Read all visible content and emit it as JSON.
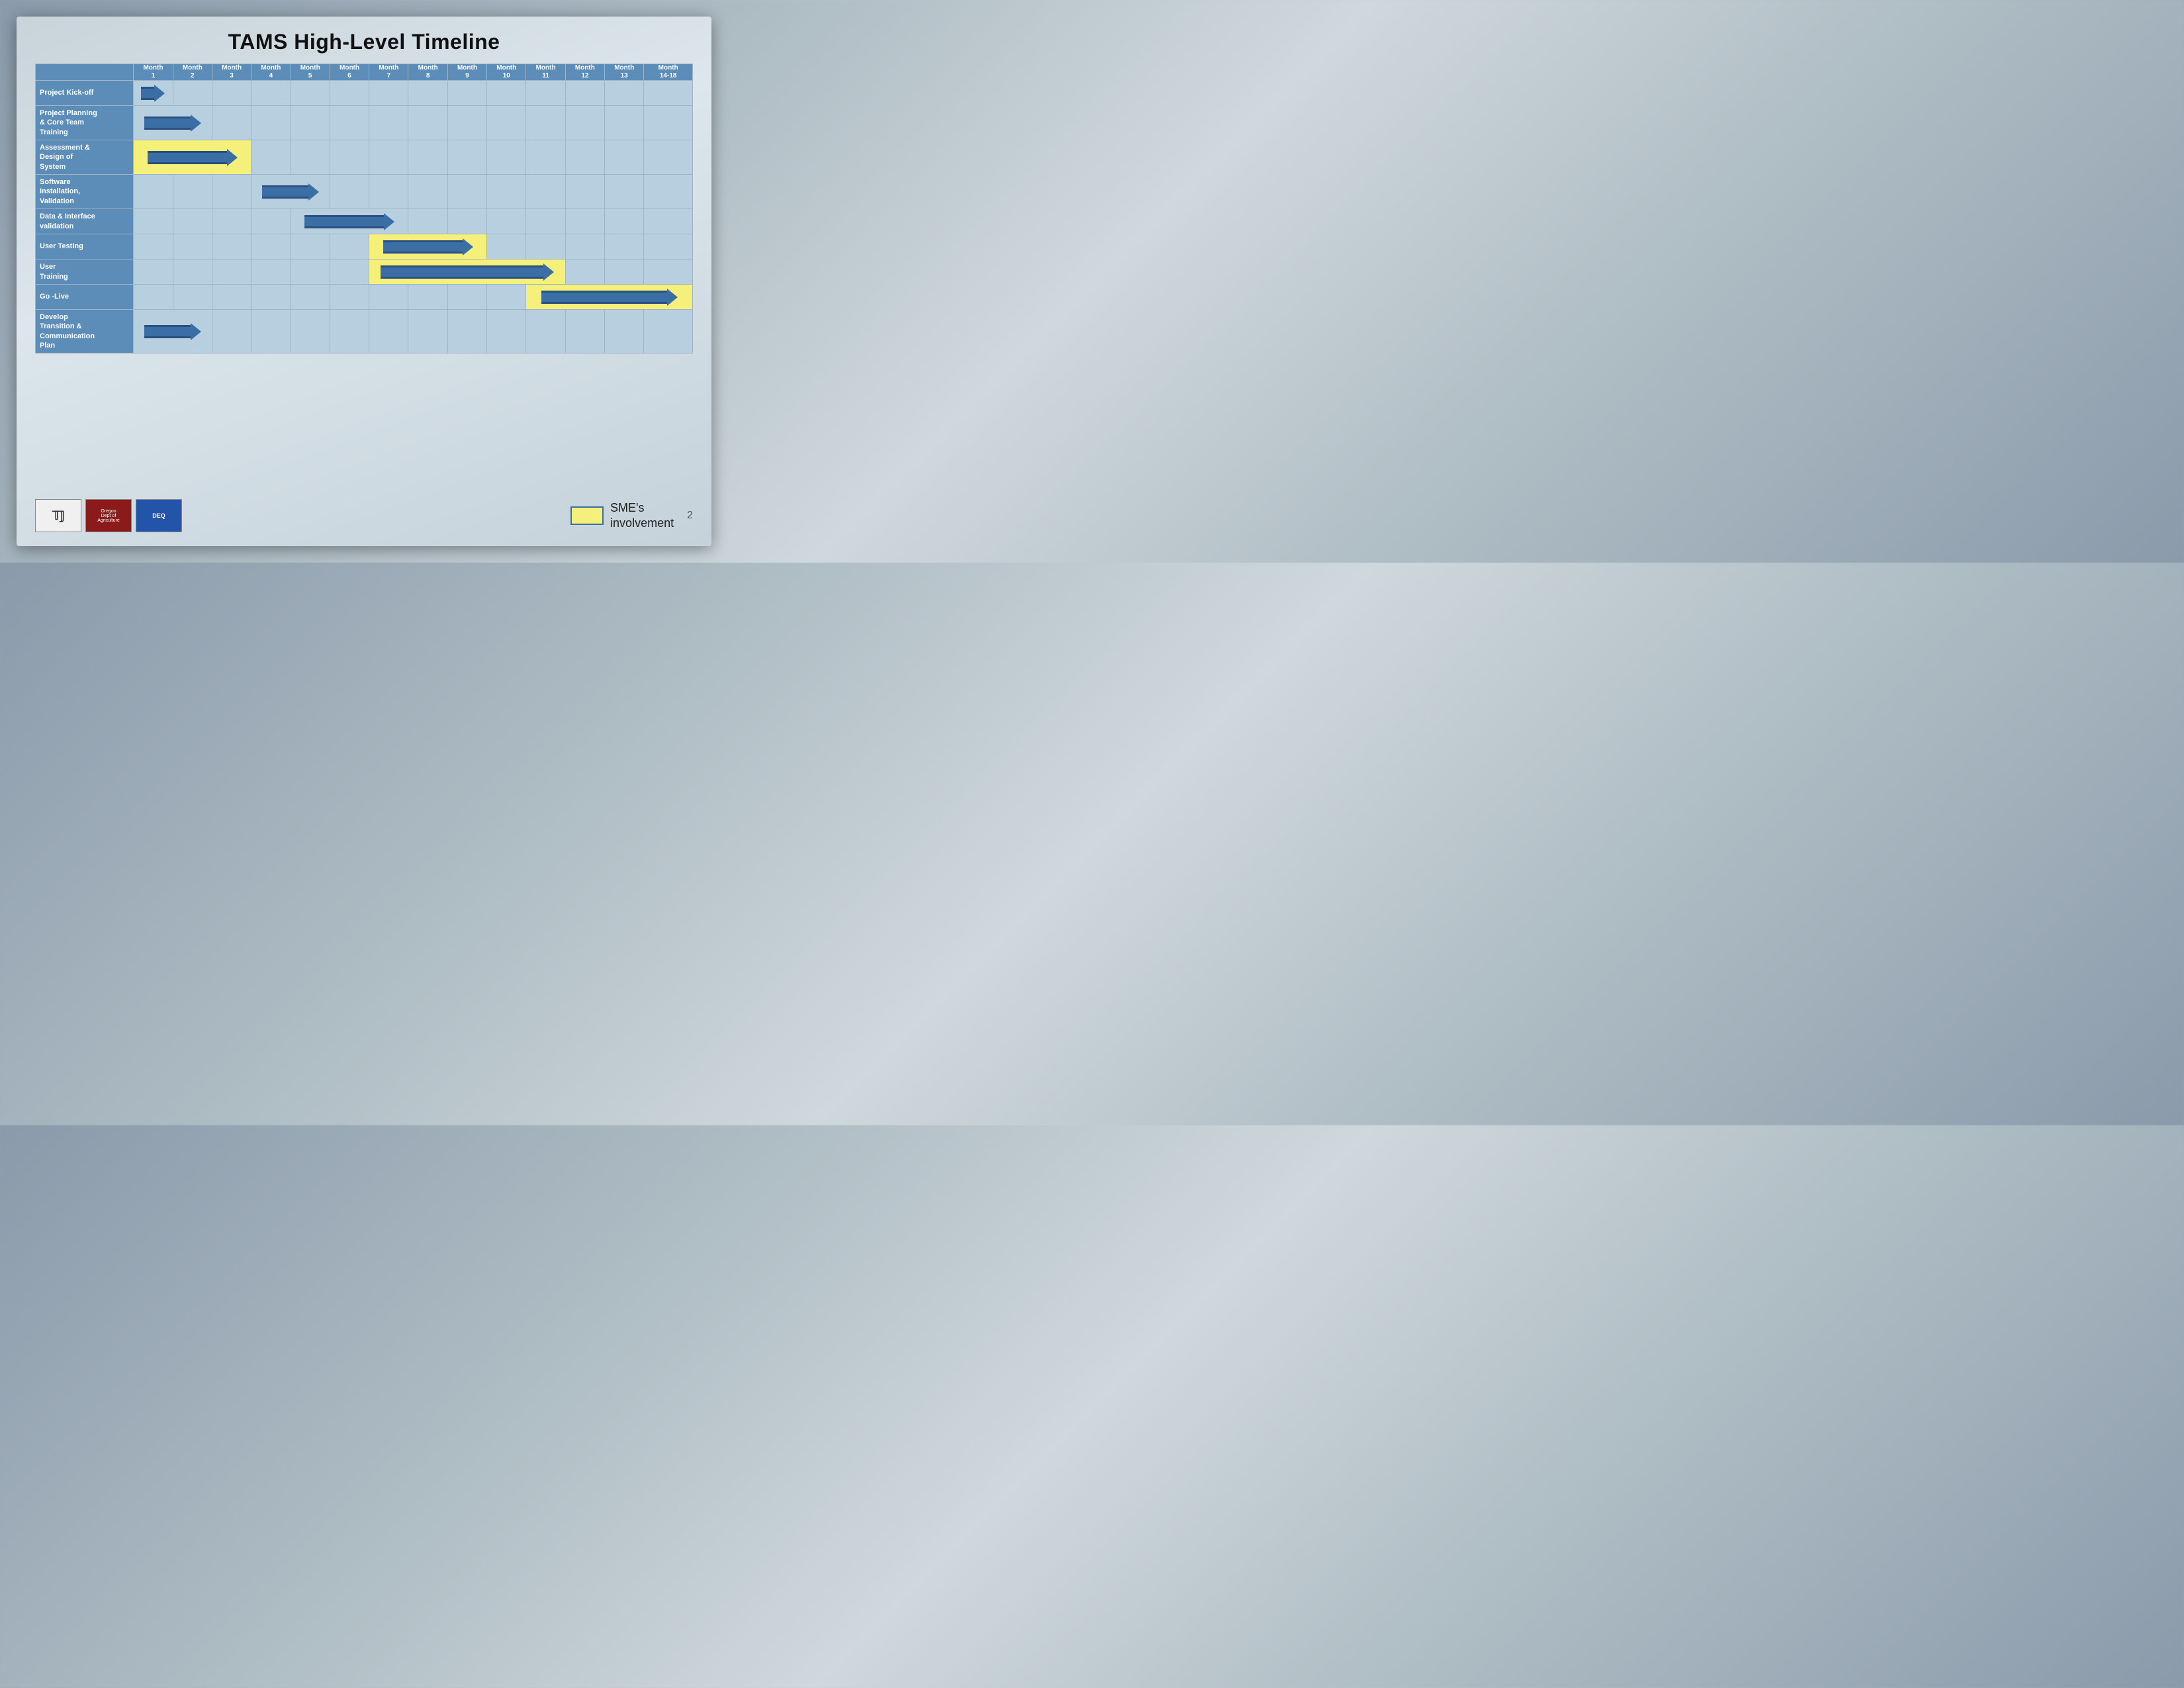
{
  "title": "TAMS High-Level Timeline",
  "header": {
    "label_col": "",
    "months": [
      {
        "label": "Month",
        "sub": "1"
      },
      {
        "label": "Month",
        "sub": "2"
      },
      {
        "label": "Month",
        "sub": "3"
      },
      {
        "label": "Month",
        "sub": "4"
      },
      {
        "label": "Month",
        "sub": "5"
      },
      {
        "label": "Month",
        "sub": "6"
      },
      {
        "label": "Month",
        "sub": "7"
      },
      {
        "label": "Month",
        "sub": "8"
      },
      {
        "label": "Month",
        "sub": "9"
      },
      {
        "label": "Month",
        "sub": "10"
      },
      {
        "label": "Month",
        "sub": "11"
      },
      {
        "label": "Month",
        "sub": "12"
      },
      {
        "label": "Month",
        "sub": "13"
      },
      {
        "label": "Month",
        "sub": "14-18"
      }
    ]
  },
  "tasks": [
    {
      "label": "Project Kick-off",
      "arrow_start": 1,
      "arrow_end": 1,
      "highlight": false,
      "row_height": "normal"
    },
    {
      "label": "Project Planning & Core Team Training",
      "arrow_start": 1,
      "arrow_end": 2,
      "highlight": false,
      "row_height": "tall"
    },
    {
      "label": "Assessment & Design of System",
      "arrow_start": 1,
      "arrow_end": 3,
      "highlight": true,
      "row_height": "tall"
    },
    {
      "label": "Software Installation, Validation",
      "arrow_start": 4,
      "arrow_end": 5,
      "highlight": false,
      "row_height": "tall"
    },
    {
      "label": "Data & Interface validation",
      "arrow_start": 5,
      "arrow_end": 7,
      "highlight": false,
      "row_height": "normal"
    },
    {
      "label": "User Testing",
      "arrow_start": 7,
      "arrow_end": 9,
      "highlight": true,
      "row_height": "normal"
    },
    {
      "label": "User Training",
      "arrow_start": 7,
      "arrow_end": 11,
      "highlight": true,
      "row_height": "normal"
    },
    {
      "label": "Go -Live",
      "arrow_start": 11,
      "arrow_end": 14,
      "highlight": true,
      "row_height": "normal"
    },
    {
      "label": "Develop Transition & Communication Plan",
      "arrow_start": 1,
      "arrow_end": 2,
      "highlight": false,
      "row_height": "xtall"
    }
  ],
  "legend": {
    "box_color": "#f5f07a",
    "text": "SME's\ninvolvement"
  },
  "footer": {
    "page_number": "2"
  }
}
